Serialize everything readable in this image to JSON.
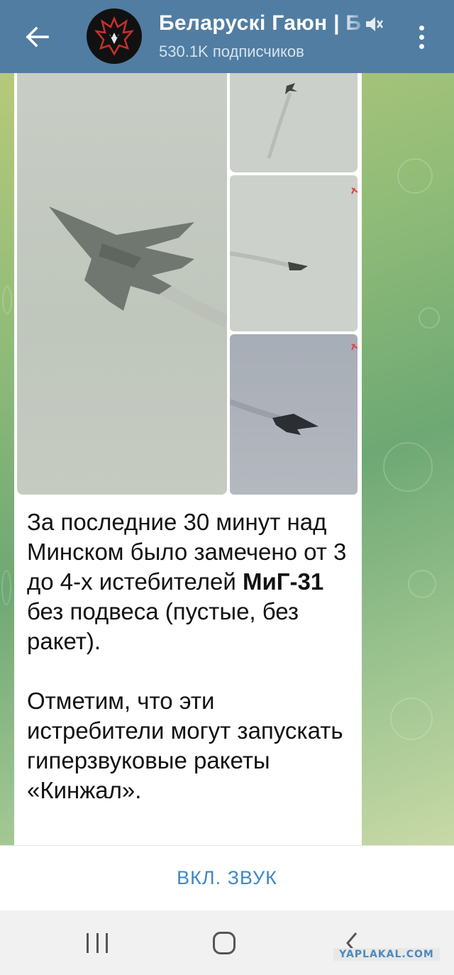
{
  "header": {
    "channel_title": "Беларускі Гаюн | Б",
    "subscribers": "530.1K подписчиков",
    "back_icon": "arrow-left-icon",
    "mute_icon": "muted-speaker-icon",
    "menu_icon": "more-vertical-icon"
  },
  "message": {
    "photos": [
      {
        "name": "jet-photo-main"
      },
      {
        "name": "jet-photo-top-right"
      },
      {
        "name": "jet-photo-middle-right"
      },
      {
        "name": "jet-photo-bottom-right"
      }
    ],
    "para1_a": "За последние 30 минут над Минском было замечено от 3 до 4-х истебителей ",
    "para1_bold": "МиГ-31",
    "para1_b": " без подвеса (пустые, без ракет).",
    "para2": "Отметим, что эти истребители могут запускать гиперзвуковые ракеты «Кинжал»."
  },
  "bottom_bar": {
    "sound_button": "ВКЛ. ЗВУК"
  },
  "system_nav": {
    "recent_icon": "recent-apps-icon",
    "home_icon": "home-icon",
    "back_icon": "nav-back-icon"
  },
  "watermark": "YAPLAKAL.COM",
  "colors": {
    "header_bg": "#517da2",
    "accent": "#3f87c6"
  }
}
